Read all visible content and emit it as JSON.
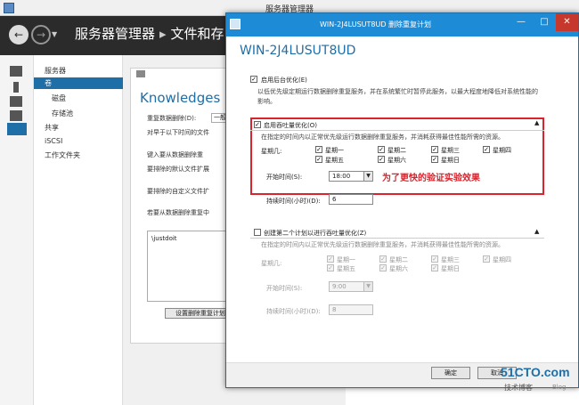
{
  "window": {
    "title": "服务器管理器"
  },
  "header": {
    "breadcrumb": [
      "服务器管理器",
      "文件和存"
    ]
  },
  "nav": {
    "items": [
      {
        "label": "服务器",
        "sub": false,
        "active": false
      },
      {
        "label": "卷",
        "sub": false,
        "active": true
      },
      {
        "label": "磁盘",
        "sub": true,
        "active": false
      },
      {
        "label": "存储池",
        "sub": true,
        "active": false
      },
      {
        "label": "共享",
        "sub": false,
        "active": false
      },
      {
        "label": "iSCSI",
        "sub": false,
        "active": false
      },
      {
        "label": "工作文件夹",
        "sub": false,
        "active": false
      }
    ]
  },
  "content": {
    "title": "Knowledges (F",
    "dedup_label": "重复数据删除(D):",
    "dedup_value": "一般",
    "age_label": "对早于以下时间的文件",
    "key_label": "键入要从数据删除重",
    "exclude_ext_label": "要排除的默认文件扩展",
    "exclude_folder_label": "要排除的自定义文件扩",
    "exclude_path_label": "若要从数据删除重复中",
    "exclude_path_value": "\\justdoit",
    "schedule_button": "设置删除重复计划"
  },
  "dialog": {
    "title": "WIN-2J4LUSUT8UD 删除重复计划",
    "heading": "WIN-2J4LUSUT8UD",
    "bg_opt_checkbox": "启用后台优化(E)",
    "bg_opt_checked": true,
    "bg_opt_desc": "以低优先级定期运行数据删除重复服务，并在系统繁忙时暂停此服务，以最大程度地降低对系统性能的影响。",
    "tp1": {
      "checkbox": "启用吞吐量优化(O)",
      "checked": true,
      "desc": "在指定的时间内以正常优先级运行数据删除重复服务，并消耗获得最佳性能所需的资源。",
      "days_label": "星期几:",
      "days": [
        {
          "label": "星期一",
          "checked": true
        },
        {
          "label": "星期二",
          "checked": true
        },
        {
          "label": "星期三",
          "checked": true
        },
        {
          "label": "星期四",
          "checked": true
        },
        {
          "label": "星期五",
          "checked": true
        },
        {
          "label": "星期六",
          "checked": true
        },
        {
          "label": "星期日",
          "checked": true
        }
      ],
      "start_label": "开始时间(S):",
      "start_value": "18:00",
      "duration_label": "持续时间(小时)(D):",
      "duration_value": "6"
    },
    "annotation": "为了更快的验证实验效果",
    "tp2": {
      "checkbox": "创建第二个计划以进行吞吐量优化(Z)",
      "checked": false,
      "desc": "在指定的时间内以正常优先级运行数据删除重复服务，并消耗获得最佳性能所需的资源。",
      "days_label": "星期几:",
      "days": [
        {
          "label": "星期一",
          "checked": true
        },
        {
          "label": "星期二",
          "checked": true
        },
        {
          "label": "星期三",
          "checked": true
        },
        {
          "label": "星期四",
          "checked": true
        },
        {
          "label": "星期五",
          "checked": true
        },
        {
          "label": "星期六",
          "checked": true
        },
        {
          "label": "星期日",
          "checked": true
        }
      ],
      "start_label": "开始时间(S):",
      "start_value": "9:00",
      "duration_label": "持续时间(小时)(D):",
      "duration_value": "8"
    },
    "ok_button": "确定",
    "cancel_button": "取消"
  },
  "watermark": {
    "main": "51CTO.com",
    "sub": "技术博客",
    "blog": "Blog"
  },
  "colors": {
    "accent": "#1e6fa8",
    "dialog_title": "#1e8bd6",
    "highlight_red": "#d9232d",
    "header_dark": "#2b2b2b"
  }
}
